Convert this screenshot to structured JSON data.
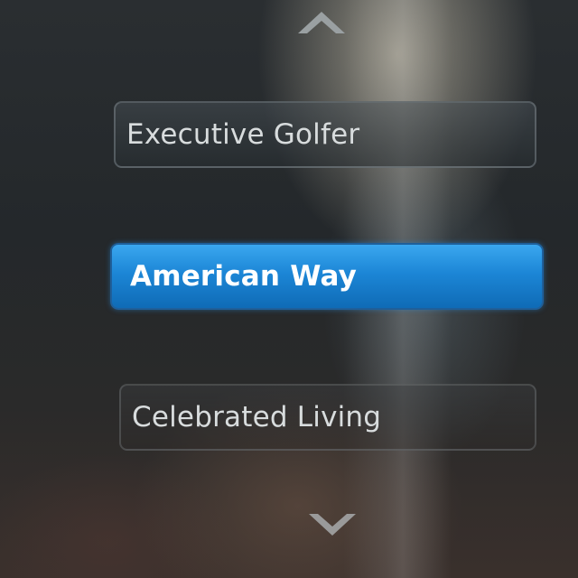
{
  "menu": {
    "items": [
      {
        "label": "Executive Golfer",
        "selected": false
      },
      {
        "label": "American Way",
        "selected": true
      },
      {
        "label": "Celebrated Living",
        "selected": false
      }
    ]
  },
  "icons": {
    "scroll_up": "chevron-up-icon",
    "scroll_down": "chevron-down-icon"
  },
  "colors": {
    "selected_background": "#1c86d6",
    "item_text": "#d8dcdd",
    "selected_text": "#ffffff"
  }
}
